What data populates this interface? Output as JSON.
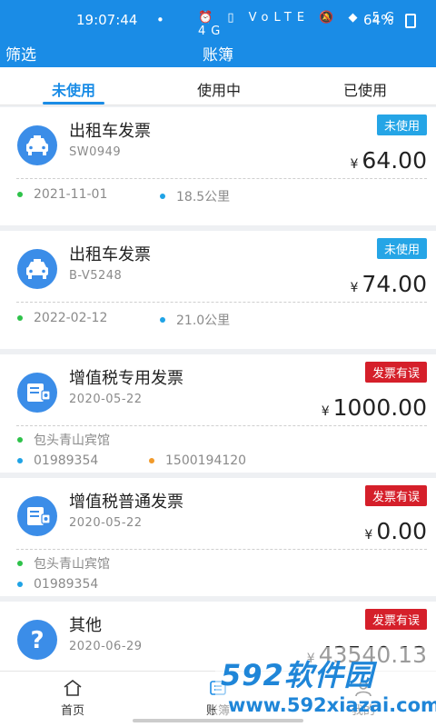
{
  "status": {
    "time": "19:07:44",
    "dot": "•",
    "icons": "⏰ ▯ VoLTE 🔕 ◆ 5G 4G",
    "battery": "64%"
  },
  "header": {
    "filter_label": "筛选",
    "title": "账簿"
  },
  "tabs": [
    {
      "label": "未使用",
      "active": true
    },
    {
      "label": "使用中",
      "active": false
    },
    {
      "label": "已使用",
      "active": false
    }
  ],
  "invoices": [
    {
      "icon": "taxi-icon",
      "name": "出租车发票",
      "code": "SW0949",
      "badge": "未使用",
      "currency": "¥",
      "amount": "64.00",
      "date": "2021-11-01",
      "distance": "18.5公里"
    },
    {
      "icon": "taxi-icon",
      "name": "出租车发票",
      "code": "B-V5248",
      "badge": "未使用",
      "currency": "¥",
      "amount": "74.00",
      "date": "2022-02-12",
      "distance": "21.0公里"
    },
    {
      "icon": "vat-invoice-icon",
      "name": "增值税专用发票",
      "date": "2020-05-22",
      "badge": "发票有误",
      "currency": "¥",
      "amount": "1000.00",
      "seller": "包头青山宾馆",
      "number": "01989354",
      "tax_id": "1500194120"
    },
    {
      "icon": "vat-invoice-icon",
      "name": "增值税普通发票",
      "date": "2020-05-22",
      "badge": "发票有误",
      "currency": "¥",
      "amount": "0.00",
      "seller": "包头青山宾馆",
      "number": "01989354"
    },
    {
      "icon": "question-icon",
      "name": "其他",
      "date": "2020-06-29",
      "badge": "发票有误",
      "currency": "¥",
      "amount": "43540.13"
    }
  ],
  "tabbar": {
    "home": "首页",
    "ledger": "账簿",
    "mine": "我的"
  },
  "watermark": {
    "main": "592软件园",
    "url": "www.592xiazai.com"
  },
  "colors": {
    "primary": "#1a8ce6",
    "badge_unused": "#25a5e6",
    "badge_error": "#d51f2a"
  }
}
